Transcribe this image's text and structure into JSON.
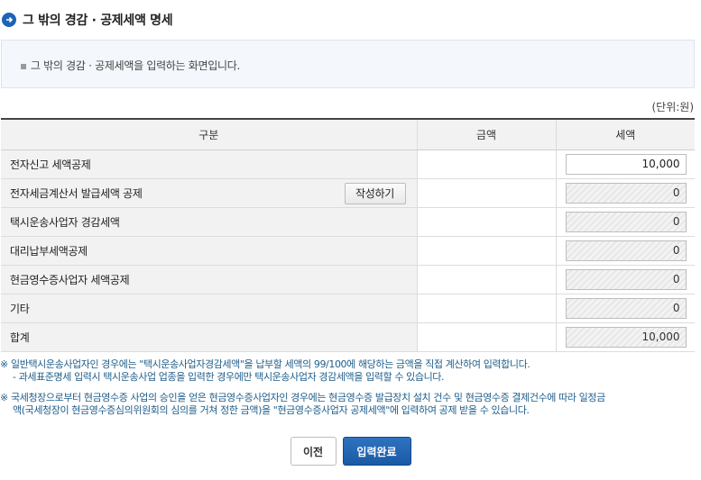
{
  "page": {
    "title": "그 밖의 경감 · 공제세액 명세",
    "info": "그 밖의 경감 · 공제세액을 입력하는 화면입니다.",
    "unit": "(단위:원)"
  },
  "table": {
    "headers": {
      "category": "구분",
      "amount": "금액",
      "tax": "세액"
    },
    "rows": [
      {
        "label": "전자신고 세액공제",
        "tax": "10,000",
        "readonly": false
      },
      {
        "label": "전자세금계산서 발급세액 공제",
        "button": "작성하기",
        "tax": "0",
        "readonly": true
      },
      {
        "label": "택시운송사업자 경감세액",
        "tax": "0",
        "readonly": true
      },
      {
        "label": "대리납부세액공제",
        "tax": "0",
        "readonly": true
      },
      {
        "label": "현금영수증사업자 세액공제",
        "tax": "0",
        "readonly": true
      },
      {
        "label": "기타",
        "tax": "0",
        "readonly": true
      },
      {
        "label": "합계",
        "tax": "10,000",
        "readonly": true
      }
    ]
  },
  "notes": {
    "mark": "※",
    "note1": "일반택시운송사업자인 경우에는 \"택시운송사업자경감세액\"을 납부할 세액의 99/100에 해당하는 금액을 직접 계산하여 입력합니다.",
    "note1_sub": "- 과세표준명세 입력시 택시운송사업 업종을 입력한 경우에만 택시운송사업자 경감세액을 입력할 수 있습니다.",
    "note2_line1": "국세청장으로부터 현금영수증 사업의 승인을 얻은 현금영수증사업자인 경우에는 현금영수증 발급장치 설치 건수 및 현금영수증 결제건수에 따라 일정금",
    "note2_line2": "액(국세청장이 현금영수증심의위원회의 심의를 거쳐 정한 금액)을 \"현금영수증사업자 공제세액\"에 입력하여 공제 받을 수 있습니다."
  },
  "buttons": {
    "prev": "이전",
    "done": "입력완료"
  },
  "colors": {
    "accent": "#1d64b5",
    "note_text": "#1e5d8a"
  },
  "icons": {
    "title": "arrow-right-circle-icon"
  }
}
